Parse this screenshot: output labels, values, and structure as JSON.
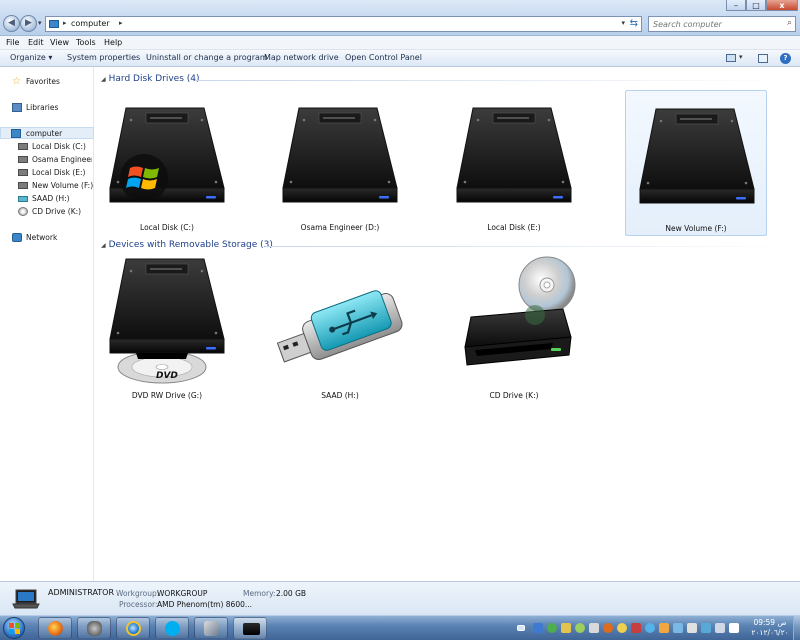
{
  "window": {
    "address_crumb": "computer",
    "search_placeholder": "Search computer",
    "controls": {
      "minimize": "–",
      "maximize": "□",
      "close": "x"
    }
  },
  "menu": [
    "File",
    "Edit",
    "View",
    "Tools",
    "Help"
  ],
  "commands": {
    "organize": "Organize ▾",
    "system_properties": "System properties",
    "uninstall": "Uninstall or change a program",
    "map_drive": "Map network drive",
    "control_panel": "Open Control Panel"
  },
  "nav": {
    "favorites": "Favorites",
    "libraries": "Libraries",
    "computer": "computer",
    "drives": [
      "Local Disk (C:)",
      "Osama  Engineer (D:)",
      "Local Disk (E:)",
      "New Volume (F:)",
      "SAAD (H:)",
      "CD Drive (K:)"
    ],
    "network": "Network"
  },
  "groups": {
    "hdd": "Hard Disk Drives (4)",
    "removable": "Devices with Removable Storage (3)"
  },
  "tiles": {
    "c": "Local Disk (C:)",
    "d": "Osama  Engineer (D:)",
    "e": "Local Disk (E:)",
    "f": "New Volume (F:)",
    "g": "DVD RW Drive (G:)",
    "h": "SAAD (H:)",
    "k": "CD Drive (K:)",
    "dvd_text": "DVD"
  },
  "details": {
    "name": "ADMINISTRATOR",
    "workgroup_label": "Workgroup:",
    "workgroup": "WORKGROUP",
    "memory_label": "Memory:",
    "memory": "2.00 GB",
    "processor_label": "Processor:",
    "processor": "AMD Phenom(tm) 8600..."
  },
  "taskbar": {
    "clock_time": "09:59 ص",
    "clock_date": "٢٠١٢/٠٦/٢٠"
  },
  "colors": {
    "accent": "#1e3f8a",
    "selection": "#e4effb",
    "drive_led": "#3b6dff"
  }
}
